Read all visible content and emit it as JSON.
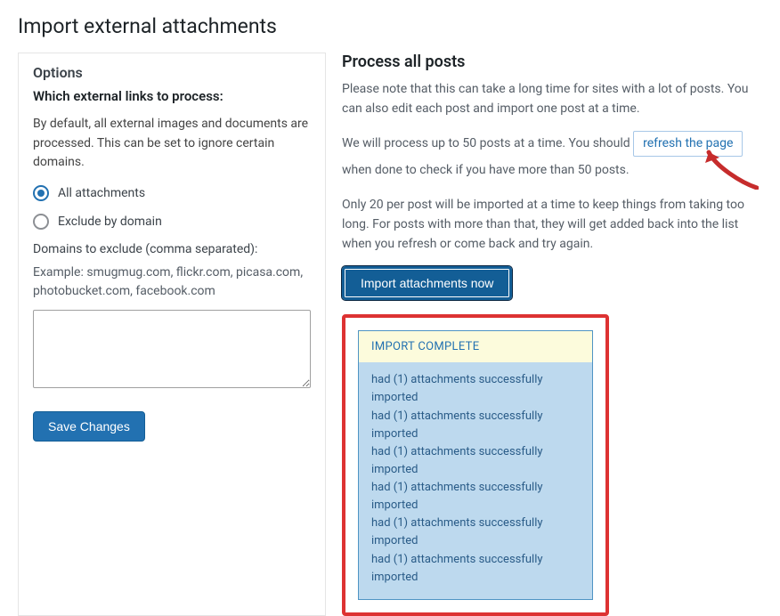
{
  "page_title": "Import external attachments",
  "options": {
    "panel_title": "Options",
    "sub_title": "Which external links to process:",
    "description": "By default, all external images and documents are processed. This can be set to ignore certain domains.",
    "radio_all": "All attachments",
    "radio_exclude": "Exclude by domain",
    "domains_label": "Domains to exclude (comma separated):",
    "domains_example": "Example: smugmug.com, flickr.com, picasa.com, photobucket.com, facebook.com",
    "domains_value": "",
    "save_label": "Save Changes"
  },
  "process": {
    "heading": "Process all posts",
    "note": "Please note that this can take a long time for sites with a lot of posts. You can also edit each post and import one post at a time.",
    "batch_pre": "We will process up to 50 posts at a time. You should ",
    "refresh_label": "refresh the page",
    "batch_post": " when done to check if you have more than 50 posts.",
    "limit_note": "Only 20 per post will be imported at a time to keep things from taking too long. For posts with more than that, they will get added back into the list when you refresh or come back and try again.",
    "import_button": "Import attachments now"
  },
  "result": {
    "header": "IMPORT COMPLETE",
    "lines": [
      "had (1) attachments successfully imported",
      "had (1) attachments successfully imported",
      "had (1) attachments successfully imported",
      "had (1) attachments successfully imported",
      "had (1) attachments successfully imported",
      "had (1) attachments successfully imported"
    ]
  }
}
